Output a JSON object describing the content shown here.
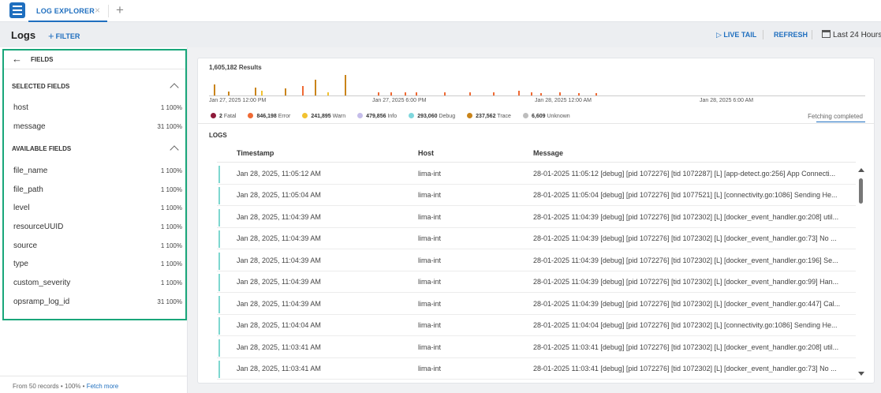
{
  "tab": {
    "label": "LOG EXPLORER",
    "close": "×",
    "add": "+"
  },
  "header": {
    "title": "Logs",
    "filter_label": "FILTER",
    "live_tail_label": "LIVE TAIL",
    "refresh_label": "REFRESH",
    "time_range": "Last 24 Hours"
  },
  "sidebar": {
    "title": "FIELDS",
    "selected_title": "SELECTED FIELDS",
    "available_title": "AVAILABLE FIELDS",
    "selected": [
      {
        "name": "host",
        "count": "1 100%"
      },
      {
        "name": "message",
        "count": "31 100%"
      }
    ],
    "available": [
      {
        "name": "file_name",
        "count": "1 100%"
      },
      {
        "name": "file_path",
        "count": "1 100%"
      },
      {
        "name": "level",
        "count": "1 100%"
      },
      {
        "name": "resourceUUID",
        "count": "1 100%"
      },
      {
        "name": "source",
        "count": "1 100%"
      },
      {
        "name": "type",
        "count": "1 100%"
      },
      {
        "name": "custom_severity",
        "count": "1 100%"
      },
      {
        "name": "opsramp_log_id",
        "count": "31 100%"
      }
    ],
    "footer": {
      "records": "From 50 records",
      "percent": "100%",
      "fetch_more": "Fetch more"
    }
  },
  "histogram": {
    "results": "1,605,182 Results",
    "ticks": [
      "Jan 27, 2025 12:00 PM",
      "Jan 27, 2025 6:00 PM",
      "Jan 28, 2025 12:00 AM",
      "Jan 28, 2025 6:00 AM"
    ],
    "fetch_status": "Fetching completed",
    "legend": [
      {
        "count": "2",
        "label": "Fatal",
        "color": "#8e1a3a"
      },
      {
        "count": "846,198",
        "label": "Error",
        "color": "#ef6a34"
      },
      {
        "count": "241,895",
        "label": "Warn",
        "color": "#f2c230"
      },
      {
        "count": "479,856",
        "label": "Info",
        "color": "#c5bdea"
      },
      {
        "count": "293,060",
        "label": "Debug",
        "color": "#7fd7dd"
      },
      {
        "count": "237,562",
        "label": "Trace",
        "color": "#c9841a"
      },
      {
        "count": "6,609",
        "label": "Unknown",
        "color": "#bdbdbd"
      }
    ]
  },
  "logs": {
    "title": "LOGS",
    "columns": {
      "timestamp": "Timestamp",
      "host": "Host",
      "message": "Message"
    },
    "rows": [
      {
        "ts": "Jan 28, 2025, 11:05:12 AM",
        "host": "lima-int",
        "msg": "28-01-2025 11:05:12 [debug] [pid 1072276] [tid 1072287] [L] [app-detect.go:256] App Connecti..."
      },
      {
        "ts": "Jan 28, 2025, 11:05:04 AM",
        "host": "lima-int",
        "msg": "28-01-2025 11:05:04 [debug] [pid 1072276] [tid 1077521] [L] [connectivity.go:1086] Sending He..."
      },
      {
        "ts": "Jan 28, 2025, 11:04:39 AM",
        "host": "lima-int",
        "msg": "28-01-2025 11:04:39 [debug] [pid 1072276] [tid 1072302] [L] [docker_event_handler.go:208] util..."
      },
      {
        "ts": "Jan 28, 2025, 11:04:39 AM",
        "host": "lima-int",
        "msg": "28-01-2025 11:04:39 [debug] [pid 1072276] [tid 1072302] [L] [docker_event_handler.go:73] No ..."
      },
      {
        "ts": "Jan 28, 2025, 11:04:39 AM",
        "host": "lima-int",
        "msg": "28-01-2025 11:04:39 [debug] [pid 1072276] [tid 1072302] [L] [docker_event_handler.go:196] Se..."
      },
      {
        "ts": "Jan 28, 2025, 11:04:39 AM",
        "host": "lima-int",
        "msg": "28-01-2025 11:04:39 [debug] [pid 1072276] [tid 1072302] [L] [docker_event_handler.go:99] Han..."
      },
      {
        "ts": "Jan 28, 2025, 11:04:39 AM",
        "host": "lima-int",
        "msg": "28-01-2025 11:04:39 [debug] [pid 1072276] [tid 1072302] [L] [docker_event_handler.go:447] Cal..."
      },
      {
        "ts": "Jan 28, 2025, 11:04:04 AM",
        "host": "lima-int",
        "msg": "28-01-2025 11:04:04 [debug] [pid 1072276] [tid 1072302] [L] [connectivity.go:1086] Sending He..."
      },
      {
        "ts": "Jan 28, 2025, 11:03:41 AM",
        "host": "lima-int",
        "msg": "28-01-2025 11:03:41 [debug] [pid 1072276] [tid 1072302] [L] [docker_event_handler.go:208] util..."
      },
      {
        "ts": "Jan 28, 2025, 11:03:41 AM",
        "host": "lima-int",
        "msg": "28-01-2025 11:03:41 [debug] [pid 1072276] [tid 1072302] [L] [docker_event_handler.go:73] No ..."
      }
    ]
  }
}
